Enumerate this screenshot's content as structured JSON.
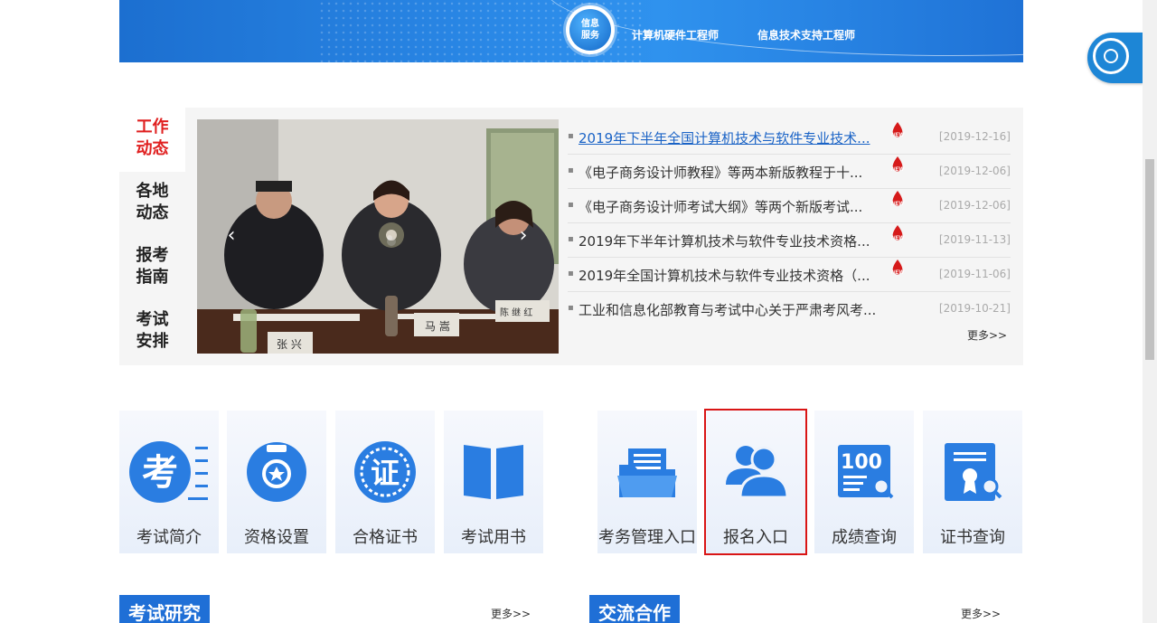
{
  "banner": {
    "badge_line1": "信息",
    "badge_line2": "服务",
    "items": [
      "计算机硬件工程师",
      "信息技术支持工程师"
    ]
  },
  "side_tabs": [
    {
      "line1": "工作",
      "line2": "动态",
      "active": true
    },
    {
      "line1": "各地",
      "line2": "动态",
      "active": false
    },
    {
      "line1": "报考",
      "line2": "指南",
      "active": false
    },
    {
      "line1": "考试",
      "line2": "安排",
      "active": false
    }
  ],
  "slider": {
    "prev_label": "‹",
    "next_label": "›",
    "nameplates": [
      "张 兴",
      "马 嵩",
      "陈 继 红"
    ]
  },
  "news": [
    {
      "title": "2019年下半年全国计算机技术与软件专业技术...",
      "date": "[2019-12-16]",
      "new": true
    },
    {
      "title": "《电子商务设计师教程》等两本新版教程于十...",
      "date": "[2019-12-06]",
      "new": true
    },
    {
      "title": "《电子商务设计师考试大纲》等两个新版考试...",
      "date": "[2019-12-06]",
      "new": true
    },
    {
      "title": "2019年下半年计算机技术与软件专业技术资格...",
      "date": "[2019-11-13]",
      "new": true
    },
    {
      "title": "2019年全国计算机技术与软件专业技术资格（...",
      "date": "[2019-11-06]",
      "new": true
    },
    {
      "title": "工业和信息化部教育与考试中心关于严肃考风考...",
      "date": "[2019-10-21]",
      "new": false
    }
  ],
  "news_more": "更多>>",
  "tiles_left": [
    {
      "label": "考试简介",
      "icon": "exam-intro-icon"
    },
    {
      "label": "资格设置",
      "icon": "medal-icon"
    },
    {
      "label": "合格证书",
      "icon": "certificate-seal-icon"
    },
    {
      "label": "考试用书",
      "icon": "book-icon"
    }
  ],
  "tiles_right": [
    {
      "label": "考务管理入口",
      "icon": "folder-documents-icon"
    },
    {
      "label": "报名入口",
      "icon": "users-icon",
      "selected": true
    },
    {
      "label": "成绩查询",
      "icon": "score-search-icon"
    },
    {
      "label": "证书查询",
      "icon": "certificate-search-icon"
    }
  ],
  "sections": [
    {
      "title": "考试研究",
      "more": "更多>>"
    },
    {
      "title": "交流合作",
      "more": "更多>>"
    }
  ],
  "colors": {
    "accent": "#1f6fd6",
    "active_tab": "#e02020",
    "link": "#1a63c6",
    "highlight_border": "#d91515"
  }
}
